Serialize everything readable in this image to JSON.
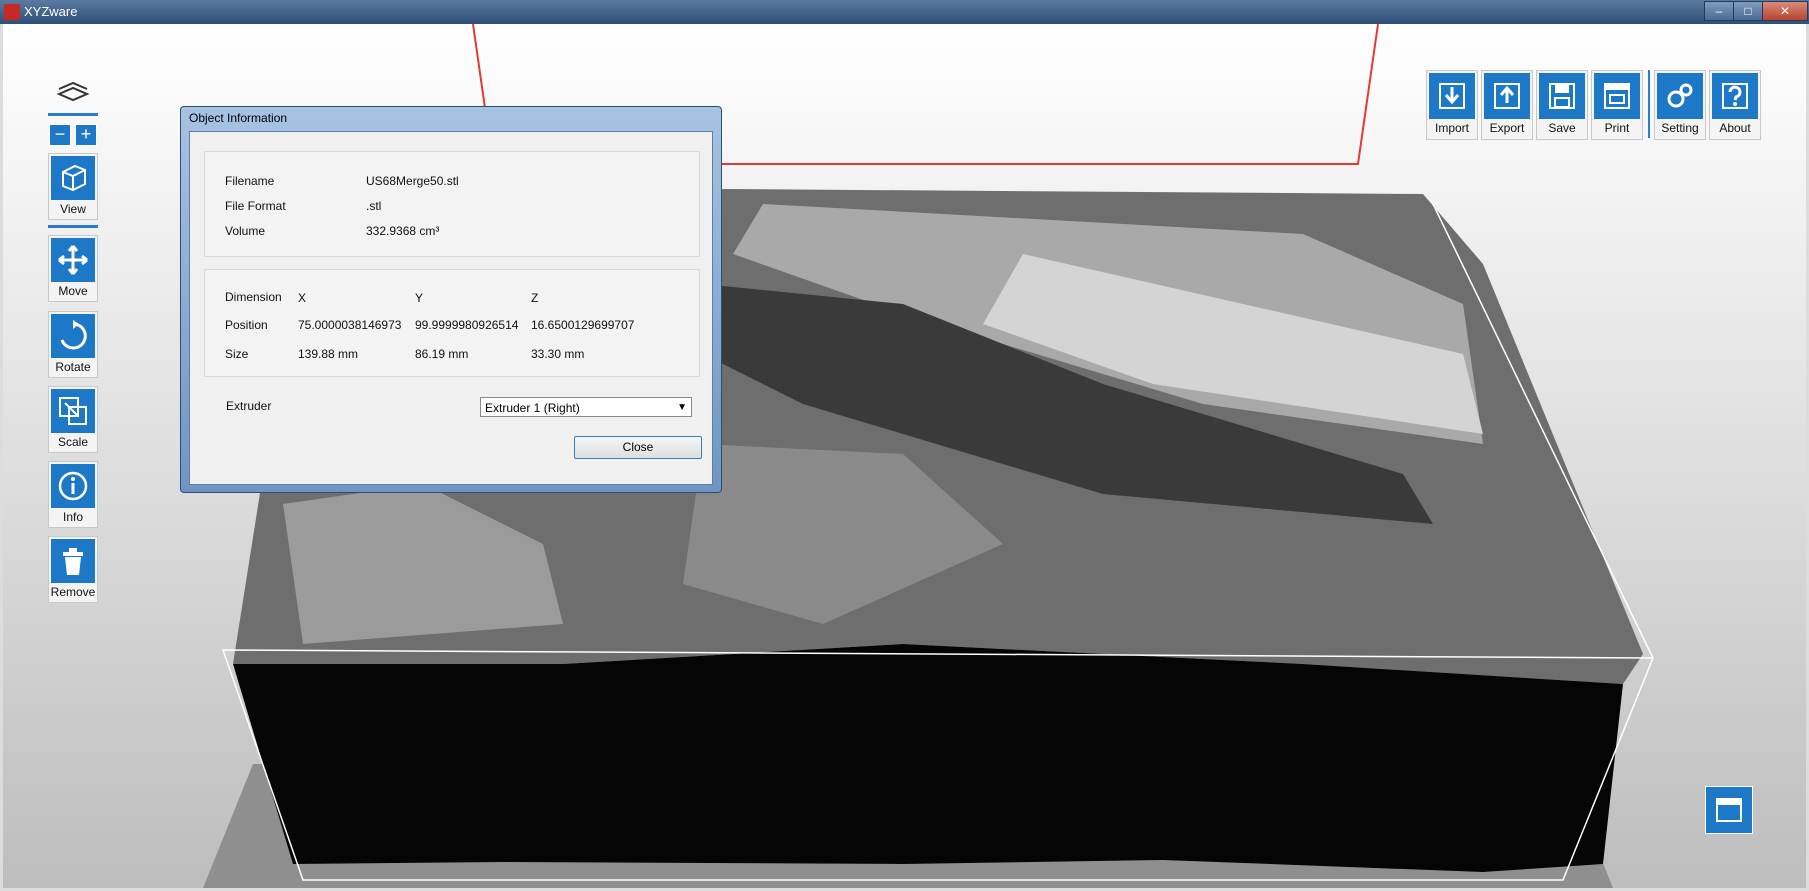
{
  "app": {
    "title": "XYZware"
  },
  "window_controls": {
    "minimize": "–",
    "maximize": "□",
    "close": "✕"
  },
  "left_toolbar": {
    "zoom_out": "−",
    "zoom_in": "+",
    "tools": [
      {
        "label": "View",
        "icon": "cube-icon"
      },
      {
        "label": "Move",
        "icon": "move-arrows-icon"
      },
      {
        "label": "Rotate",
        "icon": "rotate-icon"
      },
      {
        "label": "Scale",
        "icon": "scale-icon"
      },
      {
        "label": "Info",
        "icon": "info-icon"
      },
      {
        "label": "Remove",
        "icon": "trash-icon"
      }
    ]
  },
  "right_toolbar": {
    "tools": [
      {
        "label": "Import",
        "icon": "import-icon"
      },
      {
        "label": "Export",
        "icon": "export-icon"
      },
      {
        "label": "Save",
        "icon": "save-icon"
      },
      {
        "label": "Print",
        "icon": "print-icon"
      },
      {
        "label": "Setting",
        "icon": "gears-icon"
      },
      {
        "label": "About",
        "icon": "question-icon"
      }
    ]
  },
  "dialog": {
    "title": "Object Information",
    "file": {
      "filename_label": "Filename",
      "filename_value": "US68Merge50.stl",
      "format_label": "File Format",
      "format_value": ".stl",
      "volume_label": "Volume",
      "volume_value": "332.9368 cm³"
    },
    "dimension": {
      "header_label": "Dimension",
      "x": "X",
      "y": "Y",
      "z": "Z",
      "position_label": "Position",
      "position": [
        "75.0000038146973",
        "99.9999980926514",
        "16.6500129699707"
      ],
      "size_label": "Size",
      "size": [
        "139.88 mm",
        "86.19 mm",
        "33.30 mm"
      ]
    },
    "extruder_label": "Extruder",
    "extruder_value": "Extruder 1 (Right)",
    "close_label": "Close"
  },
  "colors": {
    "accent": "#1e78c8",
    "frame": "#e53935",
    "bed": "#9e9e9e"
  }
}
